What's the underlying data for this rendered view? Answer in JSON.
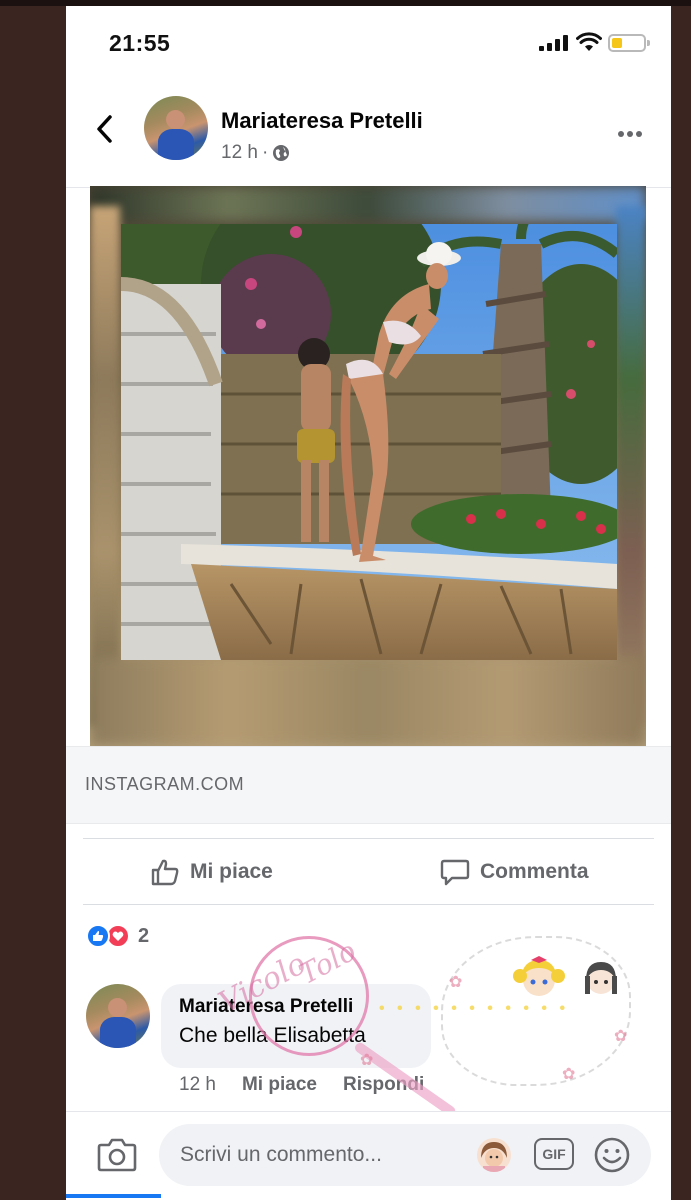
{
  "status_bar": {
    "time": "21:55",
    "battery_color": "#f5c518"
  },
  "header": {
    "back_icon": "chevron-left-icon",
    "author": "Mariateresa Pretelli",
    "time_ago": "12 h",
    "separator": "·",
    "audience_icon": "globe-icon",
    "more_icon": "ellipsis-icon"
  },
  "post": {
    "link_domain": "INSTAGRAM.COM"
  },
  "actions": {
    "like_label": "Mi piace",
    "comment_label": "Commenta"
  },
  "reactions": {
    "types": [
      "like",
      "love"
    ],
    "count": "2"
  },
  "comment": {
    "author": "Mariateresa Pretelli",
    "text": "Che bella Elisabetta",
    "time_ago": "12 h",
    "like_label": "Mi piace",
    "reply_label": "Rispondi"
  },
  "composer": {
    "placeholder": "Scrivi un commento...",
    "gif_label": "GIF"
  },
  "colors": {
    "accent": "#1877f2",
    "love": "#f33e58",
    "text_secondary": "#65676b"
  }
}
